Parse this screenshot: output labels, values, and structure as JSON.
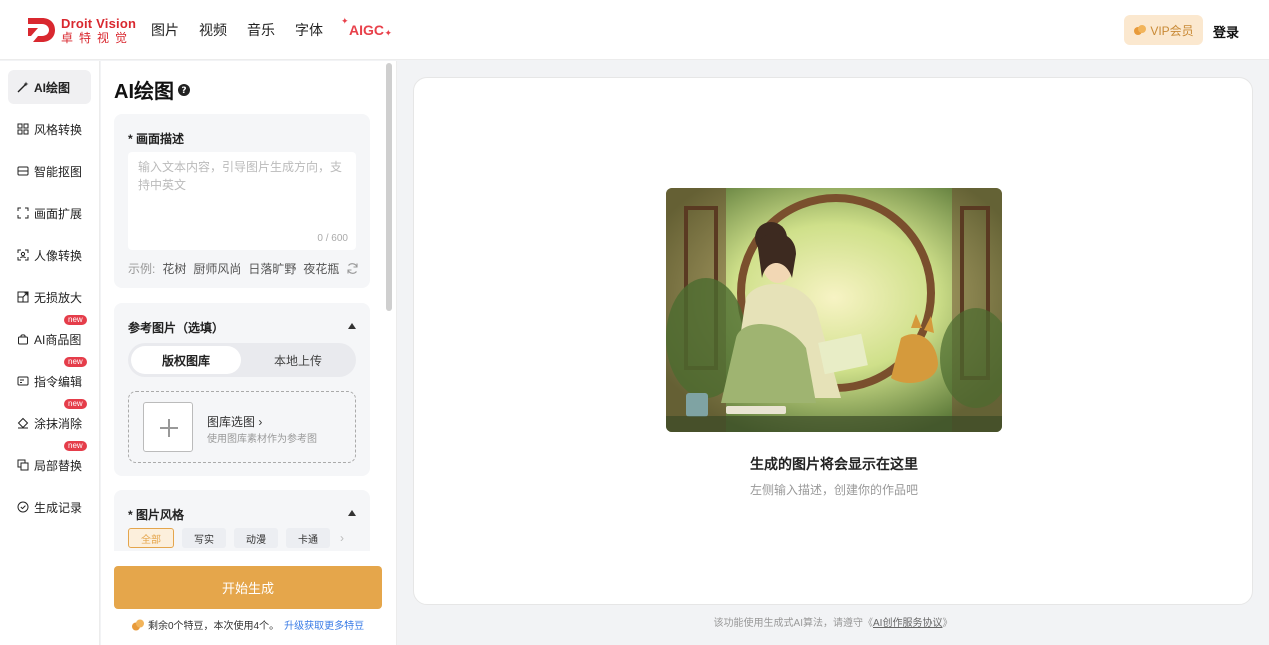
{
  "header": {
    "logo_en": "Droit Vision",
    "logo_cn": "卓特视觉",
    "nav": [
      "图片",
      "视频",
      "音乐",
      "字体"
    ],
    "nav_aigc": "AIGC",
    "vip_label": "VIP会员",
    "login_label": "登录"
  },
  "leftnav": {
    "items": [
      {
        "label": "AI绘图",
        "icon": "magic-wand-icon"
      },
      {
        "label": "风格转换",
        "icon": "grid-style-icon"
      },
      {
        "label": "智能抠图",
        "icon": "cutout-icon"
      },
      {
        "label": "画面扩展",
        "icon": "expand-icon"
      },
      {
        "label": "人像转换",
        "icon": "portrait-scan-icon"
      },
      {
        "label": "无损放大",
        "icon": "upscale-icon"
      },
      {
        "label": "AI商品图",
        "icon": "bag-icon",
        "badge": "new"
      },
      {
        "label": "指令编辑",
        "icon": "command-edit-icon",
        "badge": "new"
      },
      {
        "label": "涂抹消除",
        "icon": "eraser-icon",
        "badge": "new"
      },
      {
        "label": "局部替换",
        "icon": "replace-icon",
        "badge": "new"
      },
      {
        "label": "生成记录",
        "icon": "history-icon"
      }
    ]
  },
  "panel": {
    "title": "AI绘图",
    "description": {
      "label": "* 画面描述",
      "placeholder": "输入文本内容，引导图片生成方向，支持中英文",
      "count": "0 / 600",
      "examples_prefix": "示例:",
      "examples": [
        "花树",
        "厨师风尚",
        "日落旷野",
        "夜花瓶"
      ]
    },
    "reference": {
      "label": "参考图片（选填）",
      "tabs": [
        "版权图库",
        "本地上传"
      ],
      "upload_title": "图库选图 ›",
      "upload_sub": "使用图库素材作为参考图"
    },
    "style": {
      "label": "* 图片风格",
      "chips": [
        "全部",
        "写实",
        "动漫",
        "卡通"
      ]
    },
    "generate_label": "开始生成",
    "credits_text": "剩余0个特豆，本次使用4个。",
    "credits_link": "升级获取更多特豆"
  },
  "result": {
    "title": "生成的图片将会显示在这里",
    "subtitle": "左侧输入描述，创建你的作品吧"
  },
  "footer": {
    "note_prefix": "该功能使用生成式AI算法，请遵守《",
    "note_link": "AI创作服务协议",
    "note_suffix": "》"
  },
  "colors": {
    "accent": "#e5a64b",
    "brand_red": "#d9282f",
    "badge_red": "#e53d4a",
    "link_blue": "#3b7ce6"
  }
}
